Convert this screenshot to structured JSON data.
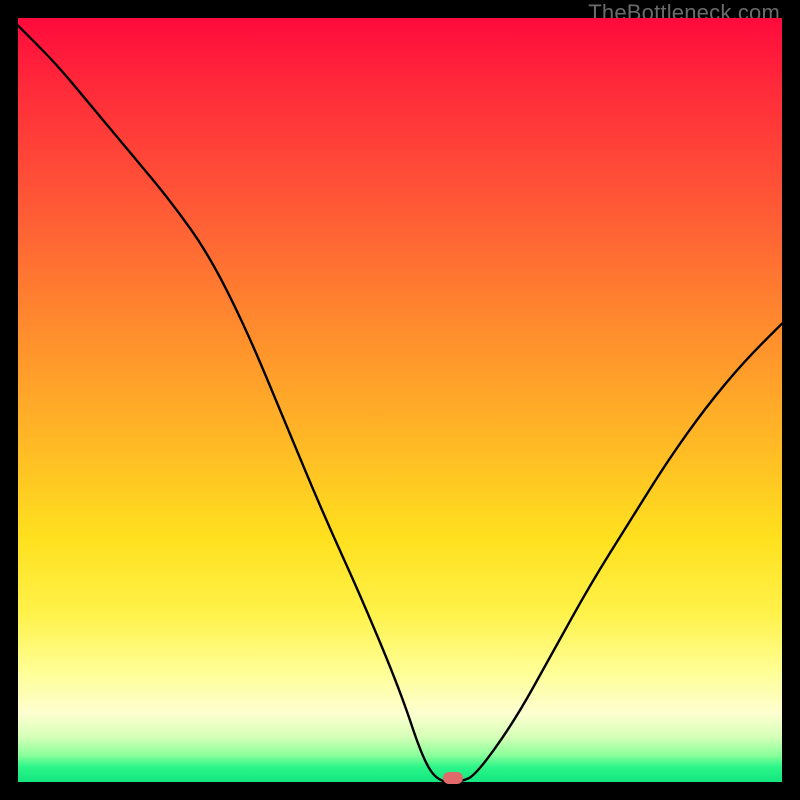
{
  "watermark": "TheBottleneck.com",
  "colors": {
    "frame": "#000000",
    "gradient_top": "#ff0a3c",
    "gradient_bottom": "#12e77e",
    "curve": "#000000",
    "marker": "#e06a6a"
  },
  "chart_data": {
    "type": "line",
    "title": "",
    "xlabel": "",
    "ylabel": "",
    "xlim": [
      0,
      100
    ],
    "ylim": [
      0,
      100
    ],
    "grid": false,
    "series": [
      {
        "name": "bottleneck-curve",
        "x": [
          0,
          5,
          10,
          15,
          20,
          25,
          30,
          35,
          40,
          45,
          50,
          53,
          55,
          58,
          60,
          65,
          70,
          75,
          80,
          85,
          90,
          95,
          100
        ],
        "values": [
          99,
          94,
          88,
          82,
          76,
          69,
          59,
          47,
          35,
          24,
          12,
          3,
          0,
          0,
          1,
          8,
          17,
          26,
          34,
          42,
          49,
          55,
          60
        ]
      }
    ],
    "annotations": [
      {
        "name": "min-marker",
        "x": 57,
        "y": 0,
        "shape": "pill",
        "color": "#e06a6a"
      }
    ]
  }
}
